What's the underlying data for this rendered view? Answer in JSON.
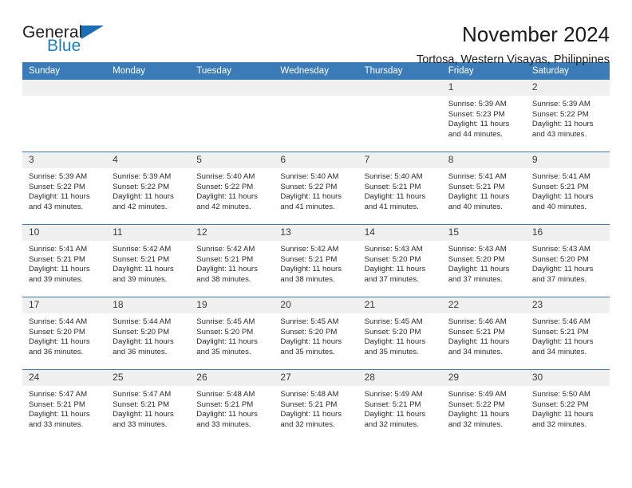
{
  "brand": {
    "name_top": "General",
    "name_bottom": "Blue",
    "color_dark": "#231f20",
    "color_blue": "#1b7fc4"
  },
  "header": {
    "title": "November 2024",
    "subtitle": "Tortosa, Western Visayas, Philippines"
  },
  "theme": {
    "header_blue": "#3b7cb8",
    "daynum_band": "#f0f0f0",
    "text": "#1a1a1a"
  },
  "weekdays": [
    "Sunday",
    "Monday",
    "Tuesday",
    "Wednesday",
    "Thursday",
    "Friday",
    "Saturday"
  ],
  "weeks": [
    [
      {
        "day": "",
        "empty": true,
        "sunrise": "",
        "sunset": "",
        "daylight_1": "",
        "daylight_2": ""
      },
      {
        "day": "",
        "empty": true,
        "sunrise": "",
        "sunset": "",
        "daylight_1": "",
        "daylight_2": ""
      },
      {
        "day": "",
        "empty": true,
        "sunrise": "",
        "sunset": "",
        "daylight_1": "",
        "daylight_2": ""
      },
      {
        "day": "",
        "empty": true,
        "sunrise": "",
        "sunset": "",
        "daylight_1": "",
        "daylight_2": ""
      },
      {
        "day": "",
        "empty": true,
        "sunrise": "",
        "sunset": "",
        "daylight_1": "",
        "daylight_2": ""
      },
      {
        "day": "1",
        "sunrise": "Sunrise: 5:39 AM",
        "sunset": "Sunset: 5:23 PM",
        "daylight_1": "Daylight: 11 hours",
        "daylight_2": "and 44 minutes."
      },
      {
        "day": "2",
        "sunrise": "Sunrise: 5:39 AM",
        "sunset": "Sunset: 5:22 PM",
        "daylight_1": "Daylight: 11 hours",
        "daylight_2": "and 43 minutes."
      }
    ],
    [
      {
        "day": "3",
        "sunrise": "Sunrise: 5:39 AM",
        "sunset": "Sunset: 5:22 PM",
        "daylight_1": "Daylight: 11 hours",
        "daylight_2": "and 43 minutes."
      },
      {
        "day": "4",
        "sunrise": "Sunrise: 5:39 AM",
        "sunset": "Sunset: 5:22 PM",
        "daylight_1": "Daylight: 11 hours",
        "daylight_2": "and 42 minutes."
      },
      {
        "day": "5",
        "sunrise": "Sunrise: 5:40 AM",
        "sunset": "Sunset: 5:22 PM",
        "daylight_1": "Daylight: 11 hours",
        "daylight_2": "and 42 minutes."
      },
      {
        "day": "6",
        "sunrise": "Sunrise: 5:40 AM",
        "sunset": "Sunset: 5:22 PM",
        "daylight_1": "Daylight: 11 hours",
        "daylight_2": "and 41 minutes."
      },
      {
        "day": "7",
        "sunrise": "Sunrise: 5:40 AM",
        "sunset": "Sunset: 5:21 PM",
        "daylight_1": "Daylight: 11 hours",
        "daylight_2": "and 41 minutes."
      },
      {
        "day": "8",
        "sunrise": "Sunrise: 5:41 AM",
        "sunset": "Sunset: 5:21 PM",
        "daylight_1": "Daylight: 11 hours",
        "daylight_2": "and 40 minutes."
      },
      {
        "day": "9",
        "sunrise": "Sunrise: 5:41 AM",
        "sunset": "Sunset: 5:21 PM",
        "daylight_1": "Daylight: 11 hours",
        "daylight_2": "and 40 minutes."
      }
    ],
    [
      {
        "day": "10",
        "sunrise": "Sunrise: 5:41 AM",
        "sunset": "Sunset: 5:21 PM",
        "daylight_1": "Daylight: 11 hours",
        "daylight_2": "and 39 minutes."
      },
      {
        "day": "11",
        "sunrise": "Sunrise: 5:42 AM",
        "sunset": "Sunset: 5:21 PM",
        "daylight_1": "Daylight: 11 hours",
        "daylight_2": "and 39 minutes."
      },
      {
        "day": "12",
        "sunrise": "Sunrise: 5:42 AM",
        "sunset": "Sunset: 5:21 PM",
        "daylight_1": "Daylight: 11 hours",
        "daylight_2": "and 38 minutes."
      },
      {
        "day": "13",
        "sunrise": "Sunrise: 5:42 AM",
        "sunset": "Sunset: 5:21 PM",
        "daylight_1": "Daylight: 11 hours",
        "daylight_2": "and 38 minutes."
      },
      {
        "day": "14",
        "sunrise": "Sunrise: 5:43 AM",
        "sunset": "Sunset: 5:20 PM",
        "daylight_1": "Daylight: 11 hours",
        "daylight_2": "and 37 minutes."
      },
      {
        "day": "15",
        "sunrise": "Sunrise: 5:43 AM",
        "sunset": "Sunset: 5:20 PM",
        "daylight_1": "Daylight: 11 hours",
        "daylight_2": "and 37 minutes."
      },
      {
        "day": "16",
        "sunrise": "Sunrise: 5:43 AM",
        "sunset": "Sunset: 5:20 PM",
        "daylight_1": "Daylight: 11 hours",
        "daylight_2": "and 37 minutes."
      }
    ],
    [
      {
        "day": "17",
        "sunrise": "Sunrise: 5:44 AM",
        "sunset": "Sunset: 5:20 PM",
        "daylight_1": "Daylight: 11 hours",
        "daylight_2": "and 36 minutes."
      },
      {
        "day": "18",
        "sunrise": "Sunrise: 5:44 AM",
        "sunset": "Sunset: 5:20 PM",
        "daylight_1": "Daylight: 11 hours",
        "daylight_2": "and 36 minutes."
      },
      {
        "day": "19",
        "sunrise": "Sunrise: 5:45 AM",
        "sunset": "Sunset: 5:20 PM",
        "daylight_1": "Daylight: 11 hours",
        "daylight_2": "and 35 minutes."
      },
      {
        "day": "20",
        "sunrise": "Sunrise: 5:45 AM",
        "sunset": "Sunset: 5:20 PM",
        "daylight_1": "Daylight: 11 hours",
        "daylight_2": "and 35 minutes."
      },
      {
        "day": "21",
        "sunrise": "Sunrise: 5:45 AM",
        "sunset": "Sunset: 5:20 PM",
        "daylight_1": "Daylight: 11 hours",
        "daylight_2": "and 35 minutes."
      },
      {
        "day": "22",
        "sunrise": "Sunrise: 5:46 AM",
        "sunset": "Sunset: 5:21 PM",
        "daylight_1": "Daylight: 11 hours",
        "daylight_2": "and 34 minutes."
      },
      {
        "day": "23",
        "sunrise": "Sunrise: 5:46 AM",
        "sunset": "Sunset: 5:21 PM",
        "daylight_1": "Daylight: 11 hours",
        "daylight_2": "and 34 minutes."
      }
    ],
    [
      {
        "day": "24",
        "sunrise": "Sunrise: 5:47 AM",
        "sunset": "Sunset: 5:21 PM",
        "daylight_1": "Daylight: 11 hours",
        "daylight_2": "and 33 minutes."
      },
      {
        "day": "25",
        "sunrise": "Sunrise: 5:47 AM",
        "sunset": "Sunset: 5:21 PM",
        "daylight_1": "Daylight: 11 hours",
        "daylight_2": "and 33 minutes."
      },
      {
        "day": "26",
        "sunrise": "Sunrise: 5:48 AM",
        "sunset": "Sunset: 5:21 PM",
        "daylight_1": "Daylight: 11 hours",
        "daylight_2": "and 33 minutes."
      },
      {
        "day": "27",
        "sunrise": "Sunrise: 5:48 AM",
        "sunset": "Sunset: 5:21 PM",
        "daylight_1": "Daylight: 11 hours",
        "daylight_2": "and 32 minutes."
      },
      {
        "day": "28",
        "sunrise": "Sunrise: 5:49 AM",
        "sunset": "Sunset: 5:21 PM",
        "daylight_1": "Daylight: 11 hours",
        "daylight_2": "and 32 minutes."
      },
      {
        "day": "29",
        "sunrise": "Sunrise: 5:49 AM",
        "sunset": "Sunset: 5:22 PM",
        "daylight_1": "Daylight: 11 hours",
        "daylight_2": "and 32 minutes."
      },
      {
        "day": "30",
        "sunrise": "Sunrise: 5:50 AM",
        "sunset": "Sunset: 5:22 PM",
        "daylight_1": "Daylight: 11 hours",
        "daylight_2": "and 32 minutes."
      }
    ]
  ]
}
